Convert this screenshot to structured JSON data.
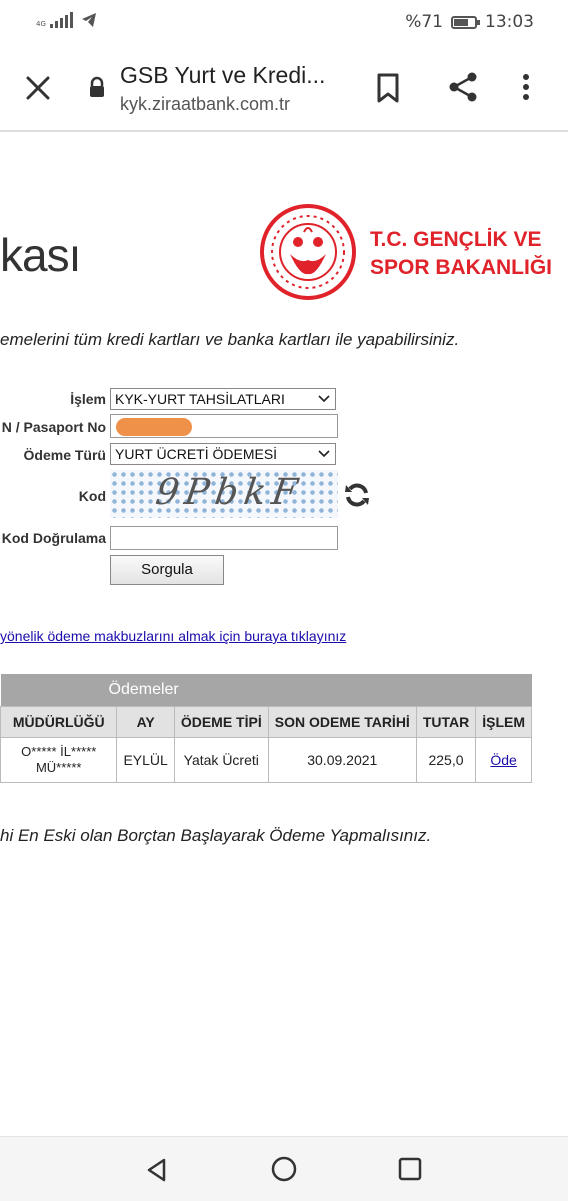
{
  "status_bar": {
    "network": "4G",
    "battery_percent": "%71",
    "battery_level": 0.71,
    "time": "13:03"
  },
  "browser": {
    "page_title": "GSB Yurt ve Kredi...",
    "url": "kyk.ziraatbank.com.tr"
  },
  "header": {
    "bank_logo_text": "kası",
    "ministry_line1": "T.C. GENÇLİK VE",
    "ministry_line2": "SPOR BAKANLIĞI"
  },
  "info_text": "emelerini tüm kredi kartları ve banka kartları ile yapabilirsiniz.",
  "form": {
    "islem_label": "İşlem",
    "islem_value": "KYK-YURT TAHSİLATLARI",
    "passport_label": "N / Pasaport No",
    "odeme_turu_label": "Ödeme Türü",
    "odeme_turu_value": "YURT ÜCRETİ ÖDEMESİ",
    "kod_label": "Kod",
    "captcha_text": "9PbkF",
    "kod_dogrulama_label": "Kod Doğrulama",
    "submit_label": "Sorgula"
  },
  "receipt_link": "yönelik ödeme makbuzlarını almak için buraya tıklayınız",
  "payments_table": {
    "caption": "Ödemeler",
    "columns": [
      "MÜDÜRLÜĞÜ",
      "AY",
      "ÖDEME TİPİ",
      "SON ODEME TARİHİ",
      "TUTAR",
      "İŞLEM"
    ],
    "rows": [
      {
        "mudurluk": "O***** İL***** MÜ*****",
        "ay": "EYLÜL",
        "odeme_tipi": "Yatak Ücreti",
        "son_odeme": "30.09.2021",
        "tutar": "225,0",
        "islem": "Öde"
      }
    ]
  },
  "bottom_note": "hi En Eski olan Borçtan Başlayarak Ödeme Yapmalısınız."
}
